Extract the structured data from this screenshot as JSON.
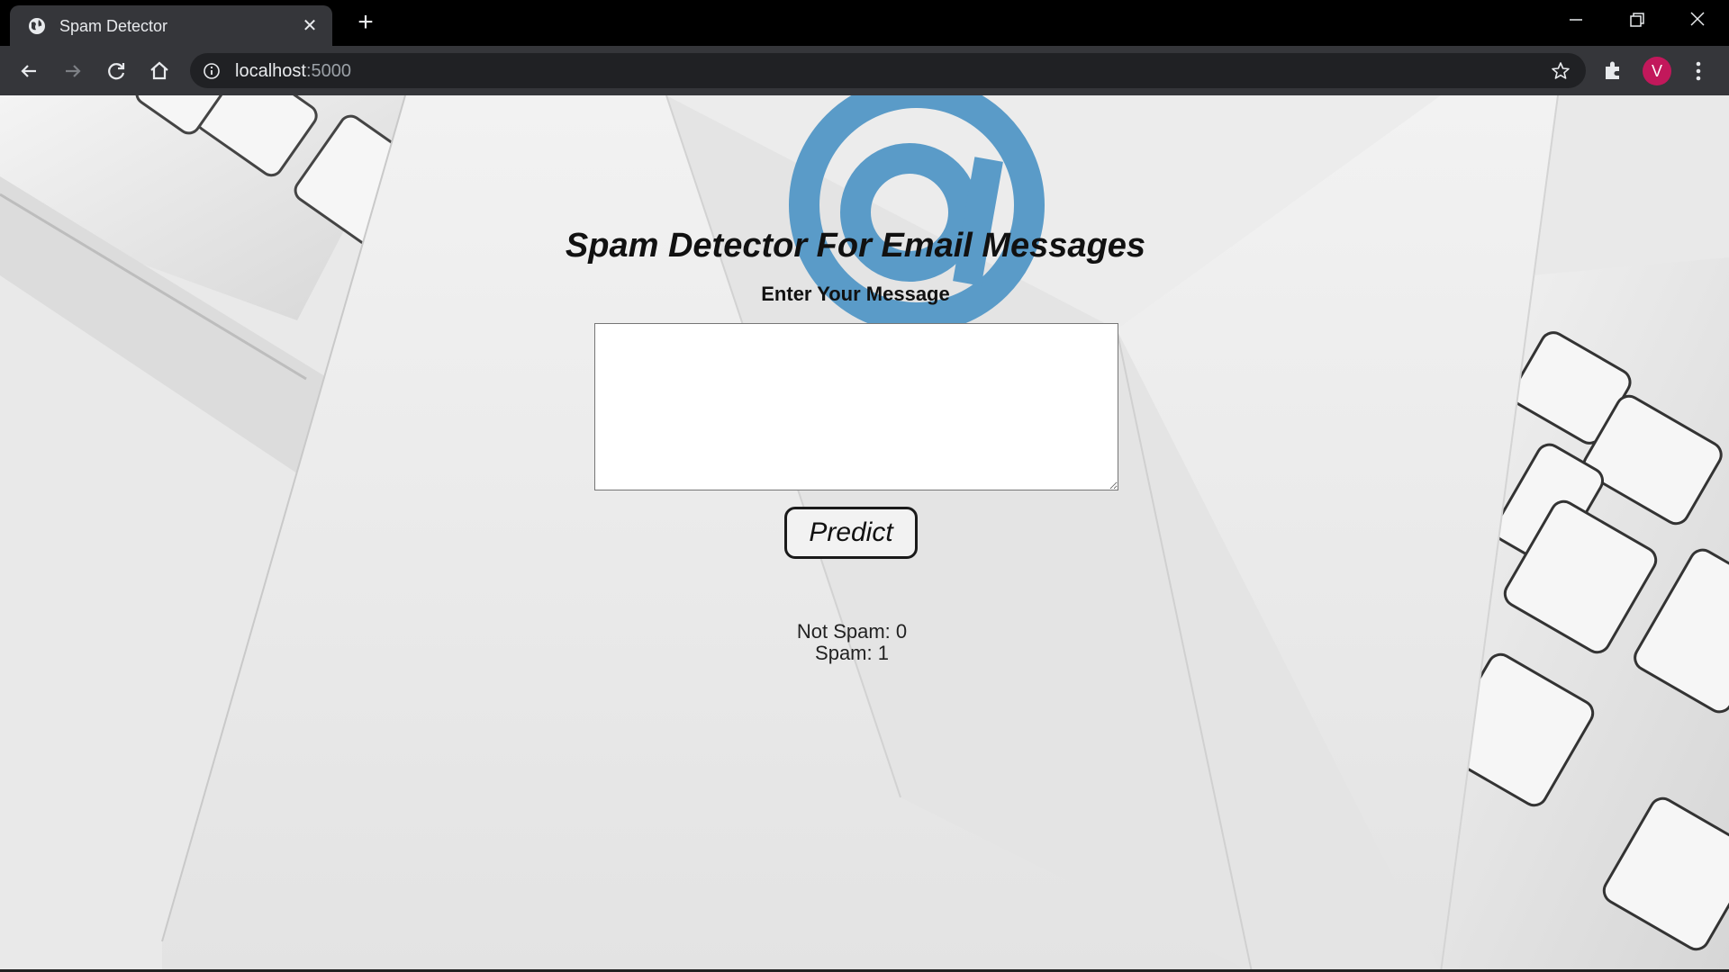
{
  "browser": {
    "tab_title": "Spam Detector",
    "url_host": "localhost",
    "url_port": ":5000",
    "profile_initial": "V",
    "profile_color": "#c2185b"
  },
  "page": {
    "title": "Spam Detector For Email Messages",
    "subtitle": "Enter Your Message",
    "message_value": "",
    "predict_label": "Predict",
    "result_not_spam": "Not Spam: 0",
    "result_spam": "Spam: 1",
    "accent_color": "#5a9bc8"
  }
}
